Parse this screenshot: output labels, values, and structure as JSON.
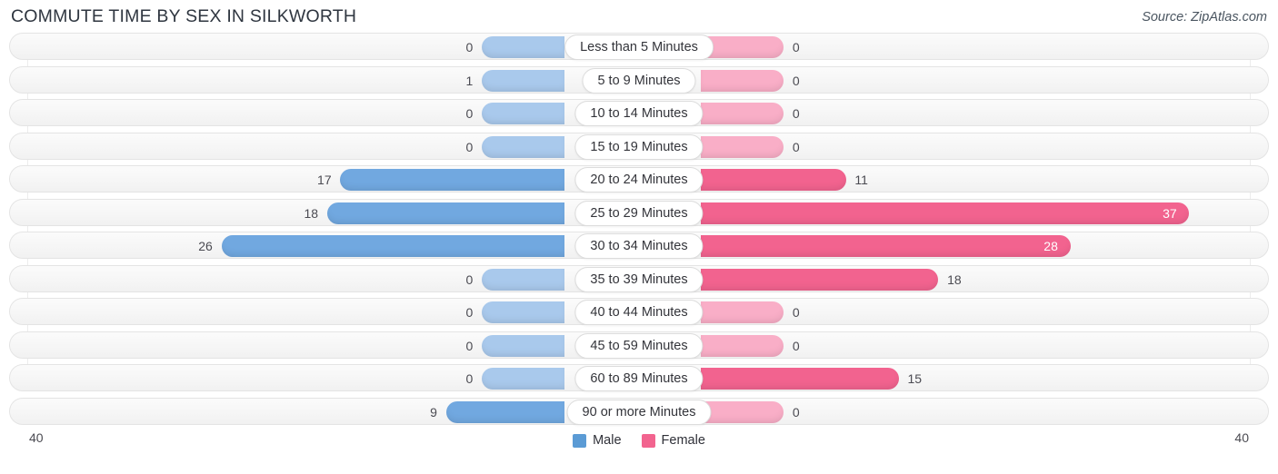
{
  "header": {
    "title": "COMMUTE TIME BY SEX IN SILKWORTH",
    "source": "Source: ZipAtlas.com"
  },
  "legend": {
    "male_label": "Male",
    "female_label": "Female",
    "male_color": "#5b9bd5",
    "female_color": "#f2648f"
  },
  "axis": {
    "left_label": "40",
    "right_label": "40",
    "max": 40
  },
  "colors": {
    "male_strong": "#71a8e0",
    "male_light": "#a9c9ec",
    "female_strong": "#f2638f",
    "female_light": "#f9aec7",
    "row_track": "#f6f6f6",
    "row_border": "#e4e4e4"
  },
  "chart_data": {
    "type": "bar",
    "title": "COMMUTE TIME BY SEX IN SILKWORTH",
    "subtitle": "Source: ZipAtlas.com",
    "orientation": "horizontal-diverging",
    "xlabel": "",
    "ylabel": "",
    "xlim": [
      40,
      40
    ],
    "grid": true,
    "legend_position": "bottom-center",
    "categories": [
      "Less than 5 Minutes",
      "5 to 9 Minutes",
      "10 to 14 Minutes",
      "15 to 19 Minutes",
      "20 to 24 Minutes",
      "25 to 29 Minutes",
      "30 to 34 Minutes",
      "35 to 39 Minutes",
      "40 to 44 Minutes",
      "45 to 59 Minutes",
      "60 to 89 Minutes",
      "90 or more Minutes"
    ],
    "series": [
      {
        "name": "Male",
        "values": [
          0,
          1,
          0,
          0,
          17,
          18,
          26,
          0,
          0,
          0,
          0,
          9
        ]
      },
      {
        "name": "Female",
        "values": [
          0,
          0,
          0,
          0,
          11,
          37,
          28,
          18,
          0,
          0,
          15,
          0
        ]
      }
    ]
  },
  "rows": [
    {
      "category": "Less than 5 Minutes",
      "male": "0",
      "female": "0"
    },
    {
      "category": "5 to 9 Minutes",
      "male": "1",
      "female": "0"
    },
    {
      "category": "10 to 14 Minutes",
      "male": "0",
      "female": "0"
    },
    {
      "category": "15 to 19 Minutes",
      "male": "0",
      "female": "0"
    },
    {
      "category": "20 to 24 Minutes",
      "male": "17",
      "female": "11"
    },
    {
      "category": "25 to 29 Minutes",
      "male": "18",
      "female": "37"
    },
    {
      "category": "30 to 34 Minutes",
      "male": "26",
      "female": "28"
    },
    {
      "category": "35 to 39 Minutes",
      "male": "0",
      "female": "18"
    },
    {
      "category": "40 to 44 Minutes",
      "male": "0",
      "female": "0"
    },
    {
      "category": "45 to 59 Minutes",
      "male": "0",
      "female": "0"
    },
    {
      "category": "60 to 89 Minutes",
      "male": "0",
      "female": "15"
    },
    {
      "category": "90 or more Minutes",
      "male": "9",
      "female": "0"
    }
  ]
}
